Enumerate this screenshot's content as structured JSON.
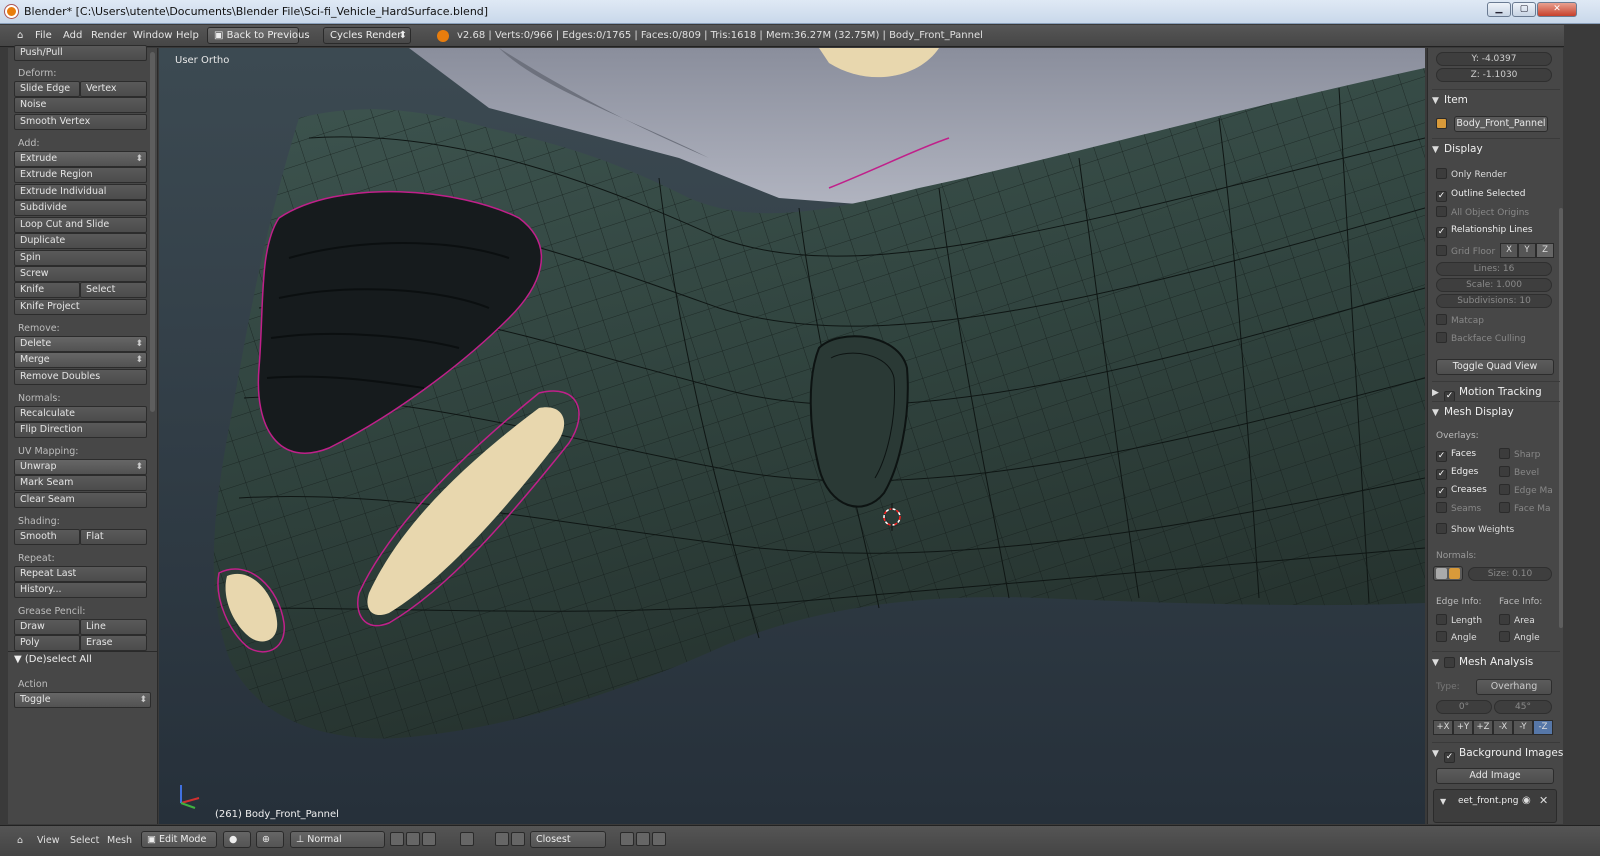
{
  "window": {
    "title": "Blender* [C:\\Users\\utente\\Documents\\Blender File\\Sci-fi_Vehicle_HardSurface.blend]",
    "min_icon": "minimize-icon",
    "max_icon": "maximize-icon",
    "close_icon": "close-icon"
  },
  "menubar": {
    "menus": [
      "File",
      "Add",
      "Render",
      "Window",
      "Help"
    ],
    "back_label": "Back to Previous",
    "render_engine": "Cycles Render",
    "stats": "v2.68 | Verts:0/966 | Edges:0/1765 | Faces:0/809 | Tris:1618 | Mem:36.27M (32.75M) | Body_Front_Pannel"
  },
  "toolshelf": {
    "top_item": "Push/Pull",
    "deform_header": "Deform:",
    "slide_edge": "Slide Edge",
    "vertex": "Vertex",
    "noise": "Noise",
    "smooth_vertex": "Smooth Vertex",
    "add_header": "Add:",
    "extrude": "Extrude",
    "extrude_region": "Extrude Region",
    "extrude_individual": "Extrude Individual",
    "subdivide": "Subdivide",
    "loop_cut": "Loop Cut and Slide",
    "duplicate": "Duplicate",
    "spin": "Spin",
    "screw": "Screw",
    "knife": "Knife",
    "select": "Select",
    "knife_project": "Knife Project",
    "remove_header": "Remove:",
    "delete": "Delete",
    "merge": "Merge",
    "remove_doubles": "Remove Doubles",
    "normals_header": "Normals:",
    "recalculate": "Recalculate",
    "flip_direction": "Flip Direction",
    "uv_header": "UV Mapping:",
    "unwrap": "Unwrap",
    "mark_seam": "Mark Seam",
    "clear_seam": "Clear Seam",
    "shading_header": "Shading:",
    "smooth": "Smooth",
    "flat": "Flat",
    "repeat_header": "Repeat:",
    "repeat_last": "Repeat Last",
    "history": "History...",
    "grease_header": "Grease Pencil:",
    "draw": "Draw",
    "line": "Line",
    "poly": "Poly",
    "erase": "Erase",
    "op_title": "(De)select All",
    "action_label": "Action",
    "action_value": "Toggle"
  },
  "viewport": {
    "view_label": "User Ortho",
    "object_label": "(261) Body_Front_Pannel"
  },
  "properties": {
    "y_field": "Y: -4.0397",
    "z_field": "Z: -1.1030",
    "item_header": "Item",
    "object_name": "Body_Front_Pannel",
    "display_header": "Display",
    "only_render": "Only Render",
    "outline_selected": "Outline Selected",
    "all_object_origins": "All Object Origins",
    "relationship_lines": "Relationship Lines",
    "grid_floor": "Grid Floor",
    "axis_x": "X",
    "axis_y": "Y",
    "axis_z": "Z",
    "lines": "Lines: 16",
    "scale": "Scale: 1.000",
    "subdivisions": "Subdivisions: 10",
    "matcap": "Matcap",
    "backface_culling": "Backface Culling",
    "toggle_quad": "Toggle Quad View",
    "motion_tracking": "Motion Tracking",
    "mesh_display": "Mesh Display",
    "overlays": "Overlays:",
    "faces": "Faces",
    "sharp": "Sharp",
    "edges": "Edges",
    "bevel": "Bevel",
    "creases": "Creases",
    "edge_marks": "Edge Ma",
    "seams": "Seams",
    "face_marks": "Face Ma",
    "show_weights": "Show Weights",
    "normals": "Normals:",
    "size": "Size: 0.10",
    "edge_info": "Edge Info:",
    "face_info": "Face Info:",
    "length": "Length",
    "area": "Area",
    "angle1": "Angle",
    "angle2": "Angle",
    "mesh_analysis": "Mesh Analysis",
    "type_label": "Type:",
    "type_value": "Overhang",
    "min_angle": "0°",
    "max_angle": "45°",
    "axes": [
      "+X",
      "+Y",
      "+Z",
      "-X",
      "-Y",
      "-Z"
    ],
    "background_images": "Background Images",
    "add_image": "Add Image",
    "image_name": "eet_front.png"
  },
  "bottombar": {
    "view": "View",
    "select": "Select",
    "mesh": "Mesh",
    "mode": "Edit Mode",
    "orientation": "Normal",
    "snap": "Closest"
  },
  "colors": {
    "accent": "#e87d0d",
    "mesh": "#33453f",
    "selection": "#c0208a",
    "cream": "#e8d7ae"
  }
}
